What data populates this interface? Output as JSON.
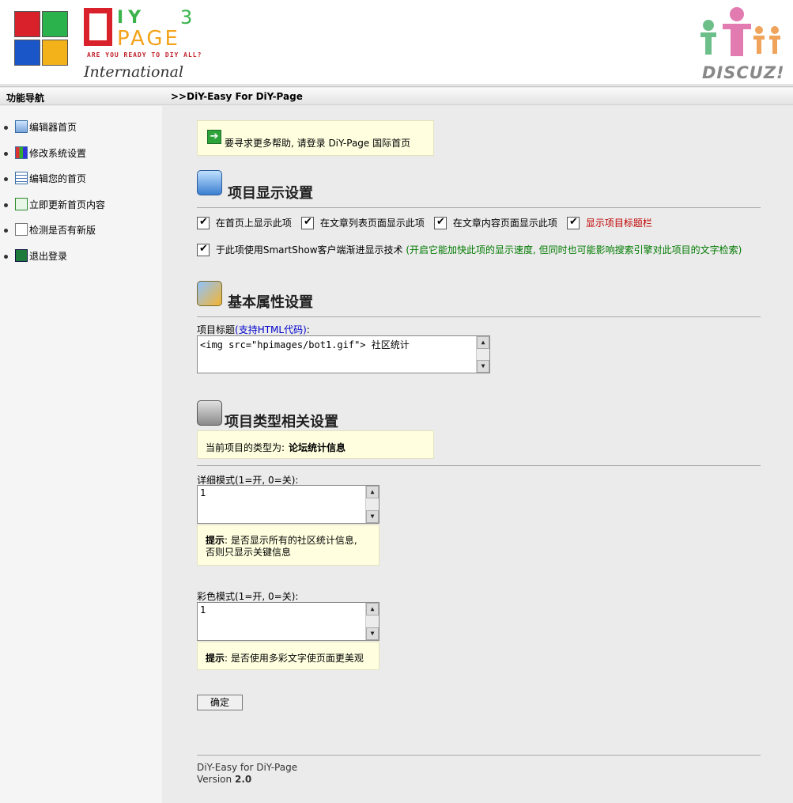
{
  "header": {
    "brand_top": "IY",
    "brand_version": "3",
    "brand_page": "PAGE",
    "tagline": "ARE YOU READY TO DIY ALL?",
    "subtitle": "International",
    "right_logo_text": "DISCUZ!"
  },
  "navbar": {
    "title": "功能导航",
    "breadcrumb": ">>DiY-Easy For DiY-Page"
  },
  "sidebar": {
    "items": [
      {
        "label": "编辑器首页",
        "icon": "editor-icon"
      },
      {
        "label": "修改系统设置",
        "icon": "settings-icon"
      },
      {
        "label": "编辑您的首页",
        "icon": "page-icon"
      },
      {
        "label": "立即更新首页内容",
        "icon": "refresh-icon"
      },
      {
        "label": "检测是否有新版",
        "icon": "search-doc-icon"
      },
      {
        "label": "退出登录",
        "icon": "logout-icon"
      }
    ]
  },
  "help": {
    "text": "要寻求更多帮助, 请登录 DiY-Page 国际首页"
  },
  "section_display": {
    "title": "项目显示设置",
    "checkboxes": [
      {
        "label": "在首页上显示此项",
        "checked": true
      },
      {
        "label": "在文章列表页面显示此项",
        "checked": true
      },
      {
        "label": "在文章内容页面显示此项",
        "checked": true
      },
      {
        "label": "显示项目标题栏",
        "checked": true
      }
    ],
    "smartshow_label": "于此项使用SmartShow客户端渐进显示技术",
    "smartshow_note": "(开启它能加快此项的显示速度, 但同时也可能影响搜索引擎对此项目的文字检索)",
    "smartshow_checked": true
  },
  "section_basic": {
    "title": "基本属性设置",
    "field_label": "项目标题",
    "field_label_note": "(支持HTML代码)",
    "field_label_colon": ":",
    "field_value": "<img src=\"hpimages/bot1.gif\"> 社区统计"
  },
  "section_type": {
    "title": "项目类型相关设置",
    "current_type_label": "当前项目的类型为:",
    "current_type_value": "论坛统计信息",
    "detail_label": "详细模式(1=开, 0=关):",
    "detail_value": "1",
    "detail_hint_bold": "提示",
    "detail_hint_line1": ": 是否显示所有的社区统计信息,",
    "detail_hint_line2": "否则只显示关键信息",
    "color_label": "彩色模式(1=开, 0=关):",
    "color_value": "1",
    "color_hint_bold": "提示",
    "color_hint": ": 是否使用多彩文字使页面更美观"
  },
  "submit_label": "确定",
  "footer": {
    "line1": "DiY-Easy for DiY-Page",
    "version_label": "Version",
    "version_value": "2.0"
  },
  "colors": {
    "red_label": "#c00000",
    "green_note": "#007a00",
    "blue_note": "#0000cc",
    "notice_bg": "#ffffe0"
  }
}
